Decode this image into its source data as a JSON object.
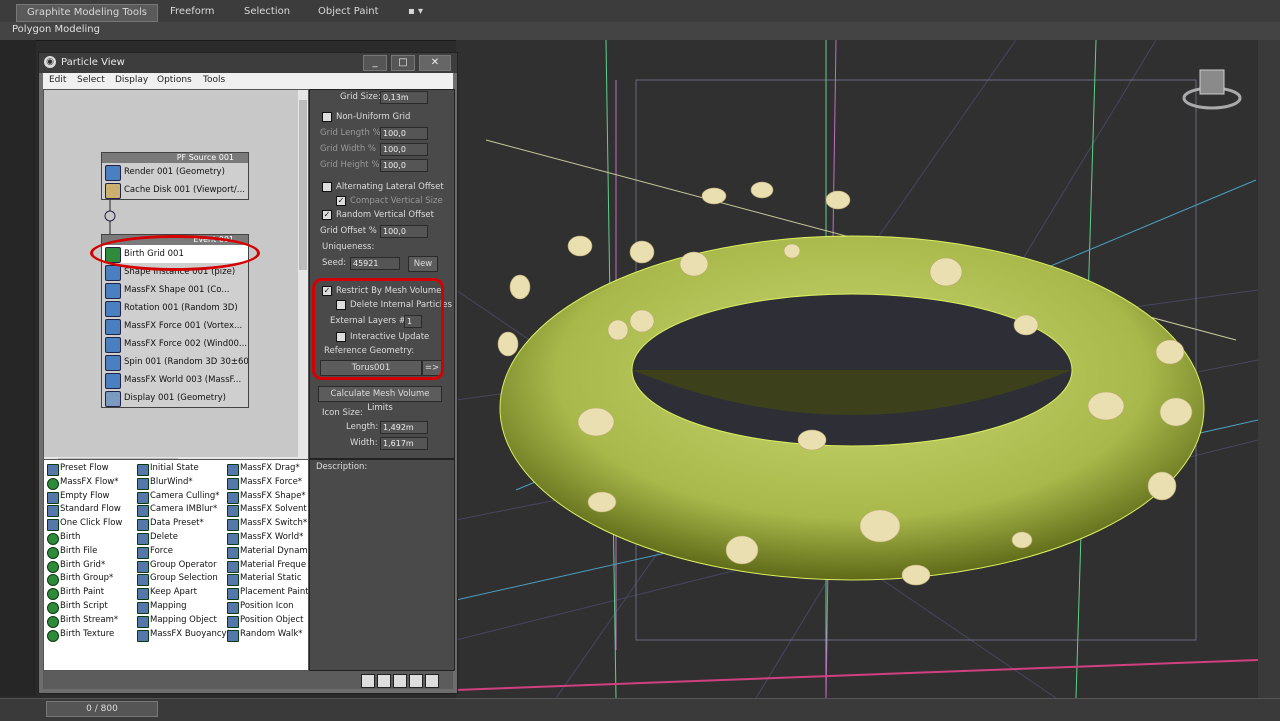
{
  "ribbon": {
    "tabs": [
      "Graphite Modeling Tools",
      "Freeform",
      "Selection",
      "Object Paint"
    ],
    "sub_label": "Polygon Modeling"
  },
  "particle_view": {
    "title": "Particle View",
    "window_buttons": [
      "_",
      "□",
      "✕"
    ],
    "menu": [
      "Edit",
      "Select",
      "Display",
      "Options",
      "Tools"
    ],
    "source_node": {
      "header": "PF Source 001",
      "operators": [
        "Render 001 (Geometry)",
        "Cache Disk 001 (Viewport/..."
      ]
    },
    "event_node": {
      "header": "Event 001",
      "operators": [
        "Birth Grid 001",
        "Shape Instance 001 (pize)",
        "MassFX Shape 001 (Co...",
        "Rotation 001 (Random 3D)",
        "MassFX Force 001 (Vortex...",
        "MassFX Force 002 (Wind00...",
        "Spin 001 (Random 3D 30±60)",
        "MassFX World 003 (MassF...",
        "Display 001 (Geometry)"
      ]
    },
    "depot": {
      "col1": [
        "Preset Flow",
        "MassFX Flow*",
        "Empty Flow",
        "Standard Flow",
        "One Click Flow",
        "Birth",
        "Birth File",
        "Birth Grid*",
        "Birth Group*",
        "Birth Paint",
        "Birth Script",
        "Birth Stream*",
        "Birth Texture"
      ],
      "col2": [
        "Initial State",
        "BlurWind*",
        "Camera Culling*",
        "Camera IMBlur*",
        "Data Preset*",
        "Delete",
        "Force",
        "Group Operator",
        "Group Selection",
        "Keep Apart",
        "Mapping",
        "Mapping Object",
        "MassFX Buoyancy*"
      ],
      "col3": [
        "MassFX Drag*",
        "MassFX Force*",
        "MassFX Shape*",
        "MassFX Solvent",
        "MassFX Switch*",
        "MassFX World*",
        "Material Dynami",
        "Material Freque",
        "Material Static",
        "Placement Paint",
        "Position Icon",
        "Position Object",
        "Random Walk*"
      ]
    },
    "params": {
      "grid_size_label": "Grid Size:",
      "grid_size": "0,13m",
      "non_uniform_grid": "Non-Uniform Grid",
      "grid_length_label": "Grid Length %",
      "grid_length": "100,0",
      "grid_width_label": "Grid Width %",
      "grid_width": "100,0",
      "grid_height_label": "Grid Height %",
      "grid_height": "100,0",
      "alt_lateral": "Alternating Lateral Offset",
      "compact_vertical": "Compact Vertical Size",
      "random_vertical": "Random Vertical Offset",
      "grid_offset_label": "Grid Offset %",
      "grid_offset": "100,0",
      "uniqueness": "Uniqueness:",
      "seed_label": "Seed:",
      "seed": "45921",
      "new_button": "New",
      "restrict_mesh": "Restrict By Mesh Volume",
      "delete_internal": "Delete Internal Particles",
      "external_layers_label": "External Layers #",
      "external_layers": "1",
      "interactive_update": "Interactive Update",
      "reference_geometry": "Reference Geometry:",
      "ref_object": "Torus001",
      "ref_arrow": "=>",
      "calc_limits": "Calculate Mesh Volume Limits",
      "icon_size": "Icon Size:",
      "length_label": "Length:",
      "length": "1,492m",
      "width_label": "Width:",
      "width": "1,617m"
    },
    "description_label": "Description:"
  },
  "timeline": {
    "frame": "0 / 800"
  },
  "colors": {
    "torus": "#a8b84a",
    "torus_dark": "#6e7a20",
    "highlight": "#d40000",
    "mushroom": "#eadfb0"
  }
}
